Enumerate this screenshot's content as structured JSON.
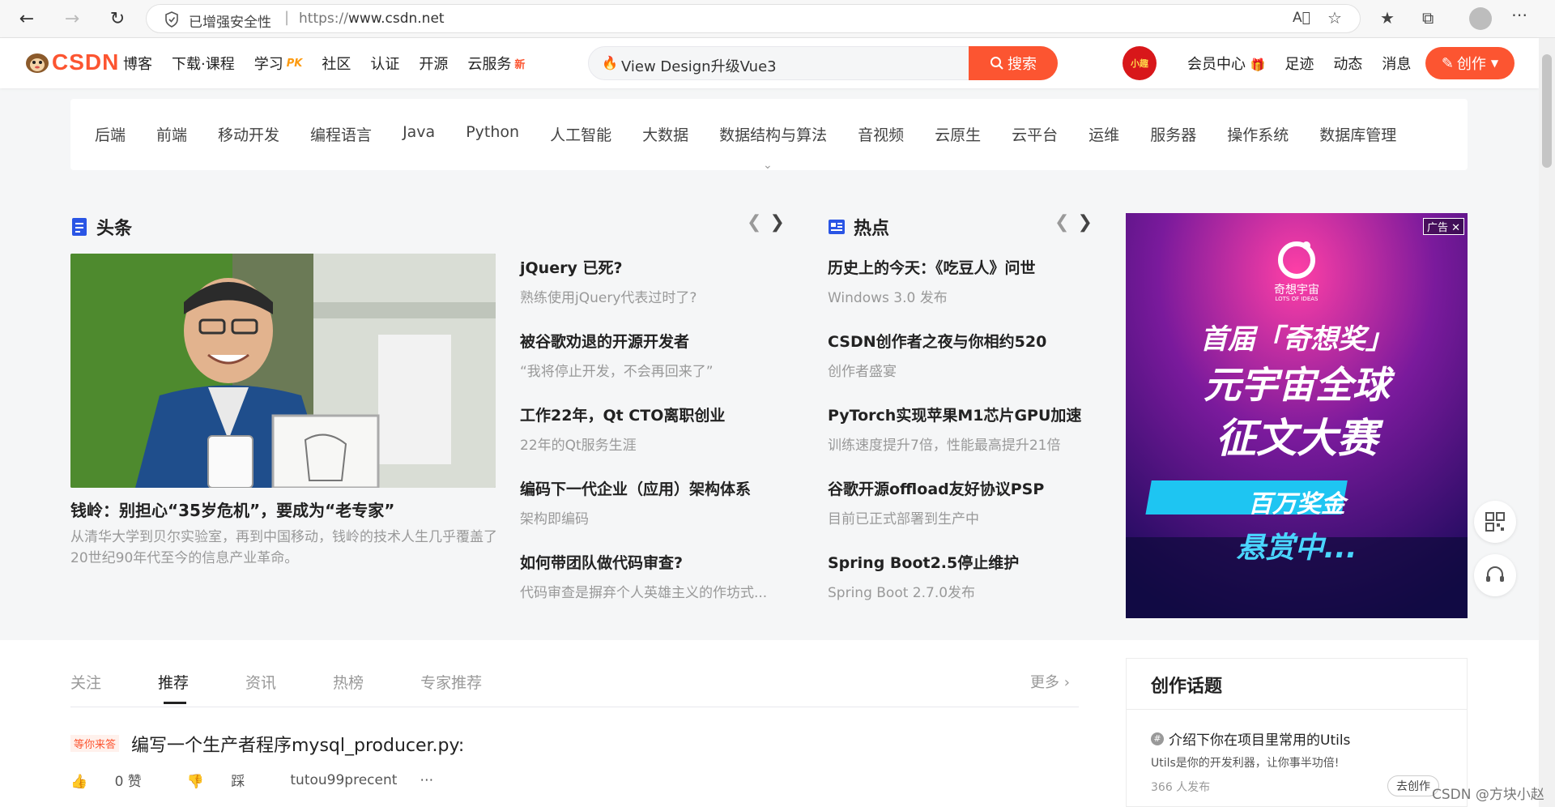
{
  "browser": {
    "security_label": "已增强安全性",
    "url_prefix": "https://",
    "url_host": "www.csdn.net"
  },
  "header": {
    "logo_text": "CSDN",
    "nav": [
      {
        "label": "博客"
      },
      {
        "label": "下载·课程"
      },
      {
        "label": "学习",
        "badge": "PK"
      },
      {
        "label": "社区"
      },
      {
        "label": "认证"
      },
      {
        "label": "开源"
      },
      {
        "label": "云服务",
        "badge": "新"
      }
    ],
    "search_query": "View Design升级Vue3",
    "search_button": "搜索",
    "avatar_text": "小趣",
    "right_nav": [
      "会员中心",
      "足迹",
      "动态",
      "消息"
    ],
    "create_button": "创作"
  },
  "categories": [
    "后端",
    "前端",
    "移动开发",
    "编程语言",
    "Java",
    "Python",
    "人工智能",
    "大数据",
    "数据结构与算法",
    "音视频",
    "云原生",
    "云平台",
    "运维",
    "服务器",
    "操作系统",
    "数据库管理"
  ],
  "headlines": {
    "title": "头条",
    "hero_title": "钱岭：别担心“35岁危机”，要成为“老专家”",
    "hero_desc": "从清华大学到贝尔实验室，再到中国移动，钱岭的技术人生几乎覆盖了20世纪90年代至今的信息产业革命。",
    "items": [
      {
        "title": "jQuery 已死?",
        "desc": "熟练使用jQuery代表过时了?"
      },
      {
        "title": "被谷歌劝退的开源开发者",
        "desc": "“我将停止开发，不会再回来了”"
      },
      {
        "title": "工作22年，Qt CTO离职创业",
        "desc": "22年的Qt服务生涯"
      },
      {
        "title": "编码下一代企业（应用）架构体系",
        "desc": "架构即编码"
      },
      {
        "title": "如何带团队做代码审查?",
        "desc": "代码审查是摒弃个人英雄主义的作坊式..."
      }
    ]
  },
  "hot": {
    "title": "热点",
    "items": [
      {
        "title": "历史上的今天：《吃豆人》问世",
        "desc": "Windows 3.0 发布"
      },
      {
        "title": "CSDN创作者之夜与你相约520",
        "desc": "创作者盛宴"
      },
      {
        "title": "PyTorch实现苹果M1芯片GPU加速",
        "desc": "训练速度提升7倍，性能最高提升21倍"
      },
      {
        "title": "谷歌开源offload友好协议PSP",
        "desc": "目前已正式部署到生产中"
      },
      {
        "title": "Spring Boot2.5停止维护",
        "desc": "Spring Boot 2.7.0发布"
      }
    ]
  },
  "ad": {
    "label": "广告",
    "brand": "奇想宇宙",
    "brand_sub": "LOTS OF IDEAS",
    "line1": "首届「奇想奖」",
    "line2": "元宇宙全球",
    "line3": "征文大赛",
    "banner": "百万奖金",
    "line4": "悬赏中..."
  },
  "feed": {
    "tabs": [
      "关注",
      "推荐",
      "资讯",
      "热榜",
      "专家推荐"
    ],
    "active_tab": "推荐",
    "more": "更多",
    "post": {
      "tag": "等你来答",
      "title": "编写一个生产者程序mysql_producer.py:",
      "likes": "0 赞",
      "dislike": "踩",
      "author": "tutou99precent"
    }
  },
  "topics": {
    "title": "创作话题",
    "item_title": "介绍下你在项目里常用的Utils",
    "item_desc": "Utils是你的开发利器，让你事半功倍!",
    "item_count": "366 人发布",
    "go_button": "去创作"
  },
  "watermark": "CSDN @方块小赵",
  "colors": {
    "brand": "#fc5531",
    "text": "#222226",
    "muted": "#999999"
  }
}
